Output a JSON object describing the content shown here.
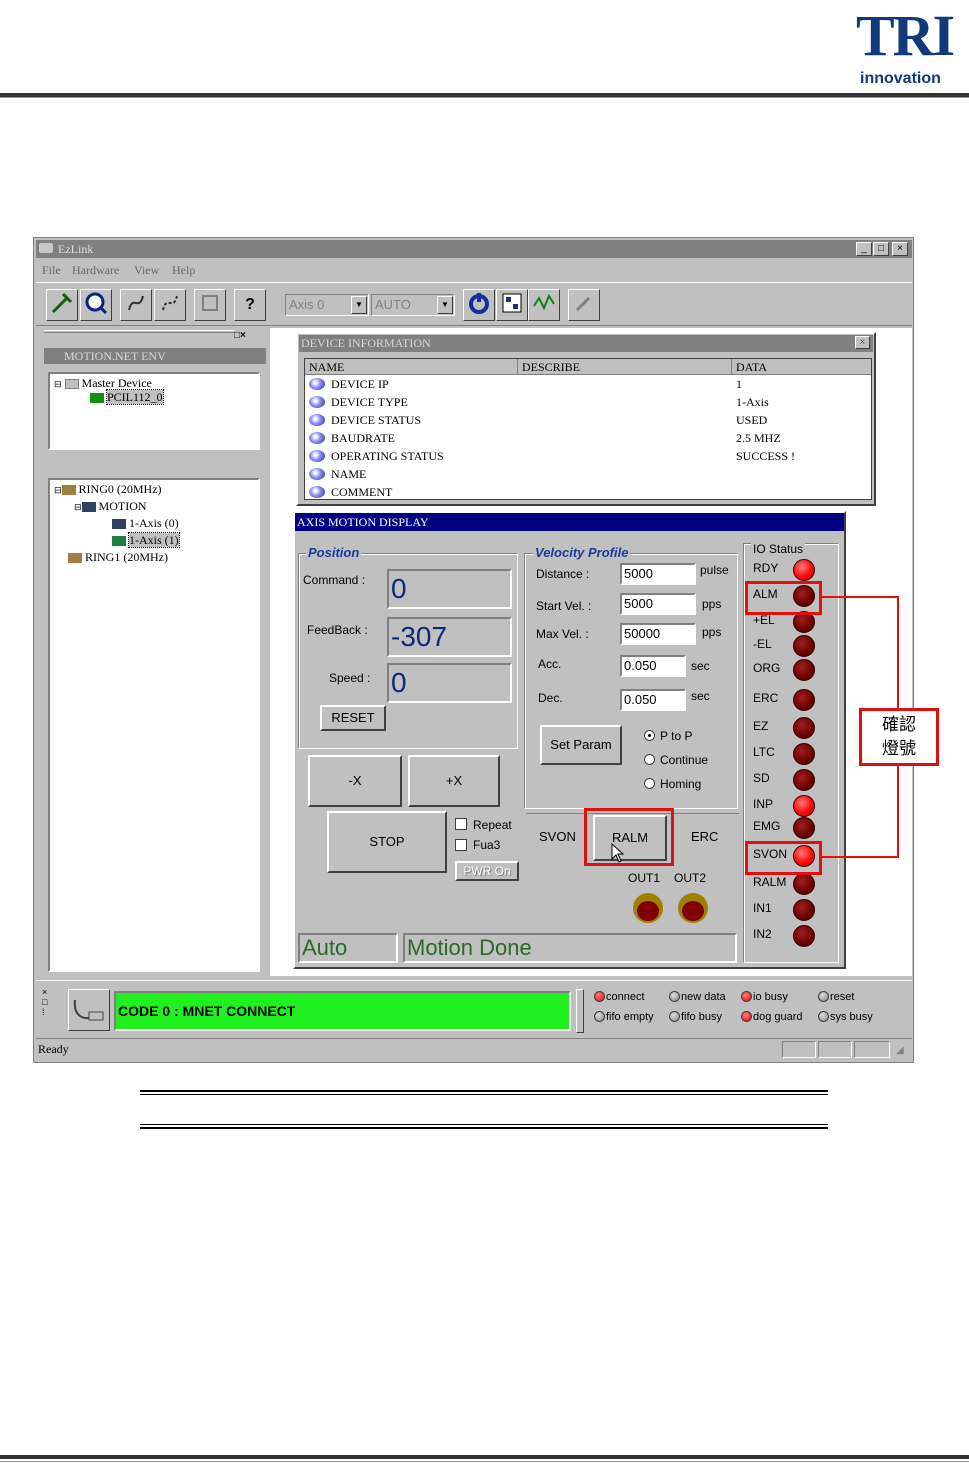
{
  "header": {
    "logo_main": "TRI",
    "logo_sub": "innovation"
  },
  "window": {
    "title": "EzLink",
    "controls": [
      "_",
      "□",
      "×"
    ]
  },
  "menu": [
    "File",
    "Hardware",
    "View",
    "Help"
  ],
  "toolbar": {
    "axis_combo": "Axis 0",
    "mode_combo": "AUTO",
    "help_glyph": "?"
  },
  "left": {
    "panel_title": "MOTION.NET ENV",
    "pane_controls": "□×",
    "device_tree": [
      "Master Device",
      "PCIL112_0"
    ],
    "ring_tree": [
      "RING0 (20MHz)",
      "MOTION",
      "1-Axis (0)",
      "1-Axis (1)",
      "RING1 (20MHz)"
    ]
  },
  "device_info": {
    "title": "DEVICE INFORMATION",
    "close": "×",
    "columns": [
      "NAME",
      "DESCRIBE",
      "DATA"
    ],
    "rows": [
      {
        "name": "DEVICE IP",
        "data": "1"
      },
      {
        "name": "DEVICE TYPE",
        "data": "1-Axis"
      },
      {
        "name": "DEVICE STATUS",
        "data": "USED"
      },
      {
        "name": "BAUDRATE",
        "data": "2.5 MHZ"
      },
      {
        "name": "OPERATING STATUS",
        "data": "SUCCESS !"
      },
      {
        "name": "NAME",
        "data": ""
      },
      {
        "name": "COMMENT",
        "data": ""
      }
    ]
  },
  "axis": {
    "title": "AXIS MOTION DISPLAY",
    "position": {
      "label": "Position",
      "command_label": "Command :",
      "command_value": "0",
      "feedback_label": "FeedBack :",
      "feedback_value": "-307",
      "speed_label": "Speed :",
      "speed_value": "0",
      "reset_label": "RESET"
    },
    "velocity": {
      "label": "Velocity Profile",
      "distance_label": "Distance :",
      "distance_value": "5000",
      "distance_unit": "pulse",
      "startvel_label": "Start Vel. :",
      "startvel_value": "5000",
      "startvel_unit": "pps",
      "maxvel_label": "Max Vel. :",
      "maxvel_value": "50000",
      "maxvel_unit": "pps",
      "acc_label": "Acc.",
      "acc_value": "0.050",
      "acc_unit": "sec",
      "dec_label": "Dec.",
      "dec_value": "0.050",
      "dec_unit": "sec",
      "set_param_label": "Set Param",
      "modes": [
        "P to P",
        "Continue",
        "Homing"
      ],
      "selected_mode": "P to P"
    },
    "jog": {
      "minus": "-X",
      "plus": "+X"
    },
    "stop_label": "STOP",
    "repeat_label": "Repeat",
    "fua3_label": "Fua3",
    "pwr_on_label": "PWR On",
    "svon_label": "SVON",
    "ralm_label": "RALM",
    "erc_label": "ERC",
    "out1_label": "OUT1",
    "out2_label": "OUT2",
    "mode_status": "Auto",
    "motion_status": "Motion Done",
    "io_status": {
      "label": "IO Status",
      "signals": [
        {
          "name": "RDY",
          "state": "on"
        },
        {
          "name": "ALM",
          "state": "off"
        },
        {
          "name": "+EL",
          "state": "off"
        },
        {
          "name": "-EL",
          "state": "off"
        },
        {
          "name": "ORG",
          "state": "off"
        },
        {
          "name": "ERC",
          "state": "off"
        },
        {
          "name": "EZ",
          "state": "off"
        },
        {
          "name": "LTC",
          "state": "off"
        },
        {
          "name": "SD",
          "state": "off"
        },
        {
          "name": "INP",
          "state": "on"
        },
        {
          "name": "EMG",
          "state": "off"
        },
        {
          "name": "SVON",
          "state": "on"
        },
        {
          "name": "RALM",
          "state": "off"
        },
        {
          "name": "IN1",
          "state": "off"
        },
        {
          "name": "IN2",
          "state": "off"
        }
      ]
    }
  },
  "annotation": {
    "line1": "確認",
    "line2": "燈號"
  },
  "bottom": {
    "code_text": "CODE 0 : MNET CONNECT",
    "indicators": [
      {
        "label": "connect",
        "state": "red"
      },
      {
        "label": "new data",
        "state": "grey"
      },
      {
        "label": "io busy",
        "state": "red"
      },
      {
        "label": "reset",
        "state": "grey"
      },
      {
        "label": "fifo empty",
        "state": "grey"
      },
      {
        "label": "fifo busy",
        "state": "grey"
      },
      {
        "label": "dog guard",
        "state": "red"
      },
      {
        "label": "sys busy",
        "state": "grey"
      }
    ],
    "status": "Ready"
  },
  "colors": {
    "accent_red": "#e01010",
    "title_blue": "#000080",
    "code_green": "#20f020"
  }
}
